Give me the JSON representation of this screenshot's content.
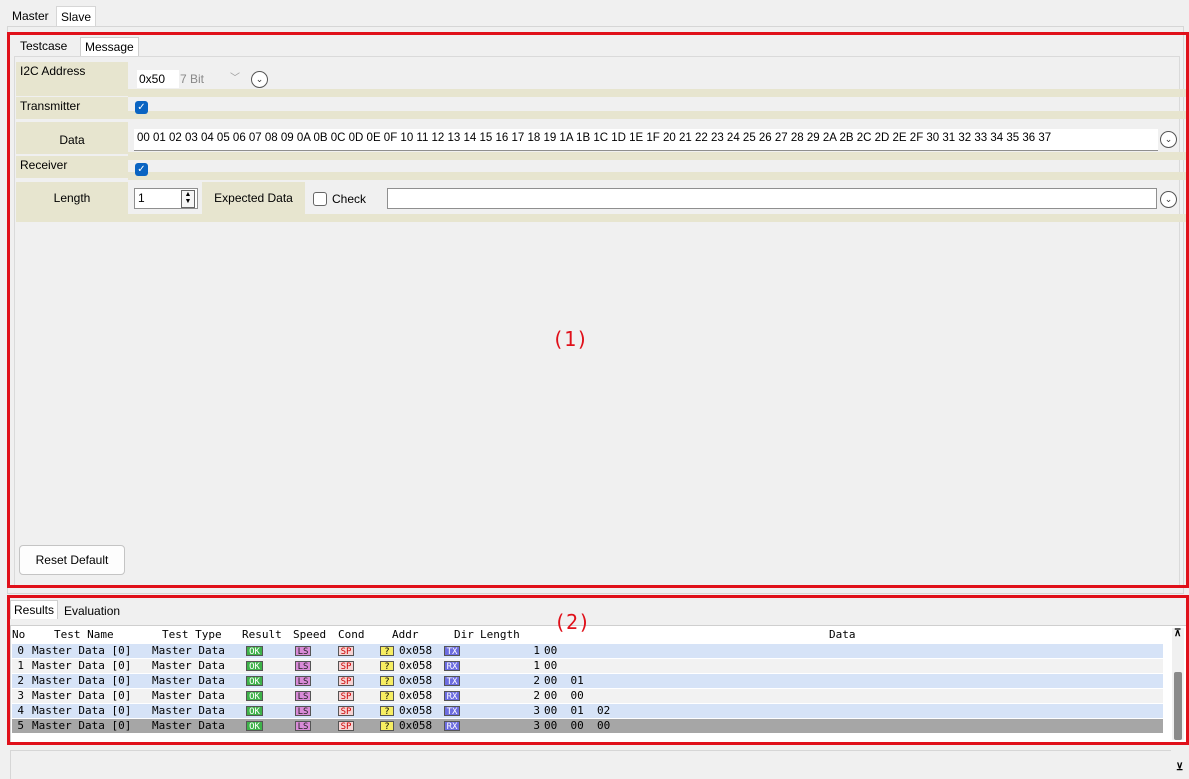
{
  "top_tabs": [
    "Master",
    "Slave"
  ],
  "sub_tabs": [
    "Testcase",
    "Message"
  ],
  "form": {
    "i2c_address_label": "I2C Address",
    "address_value": "0x50",
    "bit_mode": "7 Bit",
    "transmitter_label": "Transmitter",
    "transmitter_checked": true,
    "data_label": "Data",
    "data_value": "00 01 02 03 04 05 06 07 08 09 0A 0B 0C 0D 0E 0F 10 11 12 13 14 15 16 17 18 19 1A 1B 1C 1D 1E 1F 20 21 22 23 24 25 26 27 28 29 2A 2B 2C 2D 2E 2F 30 31 32 33 34 35 36 37",
    "receiver_label": "Receiver",
    "receiver_checked": true,
    "length_label": "Length",
    "length_value": "1",
    "expected_data_label": "Expected Data",
    "check_label": "Check",
    "check_checked": false,
    "expected_data_value": "",
    "reset_button": "Reset Default"
  },
  "annotations": {
    "region1": "(1)",
    "region2": "(2)"
  },
  "bottom_tabs": [
    "Results",
    "Evaluation"
  ],
  "results": {
    "columns": [
      "No",
      "Test Name",
      "Test Type",
      "Result",
      "Speed",
      "Cond",
      "Addr",
      "Dir",
      "Length",
      "Data"
    ],
    "rows": [
      {
        "no": "0",
        "name": "Master Data [0]",
        "type": "Master Data",
        "result": "OK",
        "speed": "LS",
        "cond": "SP",
        "addr_flag": "?",
        "addr": "0x058",
        "dir": "TX",
        "length": "1",
        "data": "00"
      },
      {
        "no": "1",
        "name": "Master Data [0]",
        "type": "Master Data",
        "result": "OK",
        "speed": "LS",
        "cond": "SP",
        "addr_flag": "?",
        "addr": "0x058",
        "dir": "RX",
        "length": "1",
        "data": "00"
      },
      {
        "no": "2",
        "name": "Master Data [0]",
        "type": "Master Data",
        "result": "OK",
        "speed": "LS",
        "cond": "SP",
        "addr_flag": "?",
        "addr": "0x058",
        "dir": "TX",
        "length": "2",
        "data": "00  01"
      },
      {
        "no": "3",
        "name": "Master Data [0]",
        "type": "Master Data",
        "result": "OK",
        "speed": "LS",
        "cond": "SP",
        "addr_flag": "?",
        "addr": "0x058",
        "dir": "RX",
        "length": "2",
        "data": "00  00"
      },
      {
        "no": "4",
        "name": "Master Data [0]",
        "type": "Master Data",
        "result": "OK",
        "speed": "LS",
        "cond": "SP",
        "addr_flag": "?",
        "addr": "0x058",
        "dir": "TX",
        "length": "3",
        "data": "00  01  02"
      },
      {
        "no": "5",
        "name": "Master Data [0]",
        "type": "Master Data",
        "result": "OK",
        "speed": "LS",
        "cond": "SP",
        "addr_flag": "?",
        "addr": "0x058",
        "dir": "RX",
        "length": "3",
        "data": "00  00  00"
      }
    ]
  },
  "colors": {
    "annotation_red": "#e0101a",
    "label_band": "#e7e5cf",
    "row_even": "#d6e3f7",
    "row_odd": "#f2f2f2",
    "row_selected": "#a6a6a6",
    "ok_badge": "#3fb24a",
    "speed_badge": "#d98bd8",
    "cond_badge": "#f6d4d4",
    "addr_badge": "#f7ee62",
    "dir_badge": "#6d6de0"
  }
}
